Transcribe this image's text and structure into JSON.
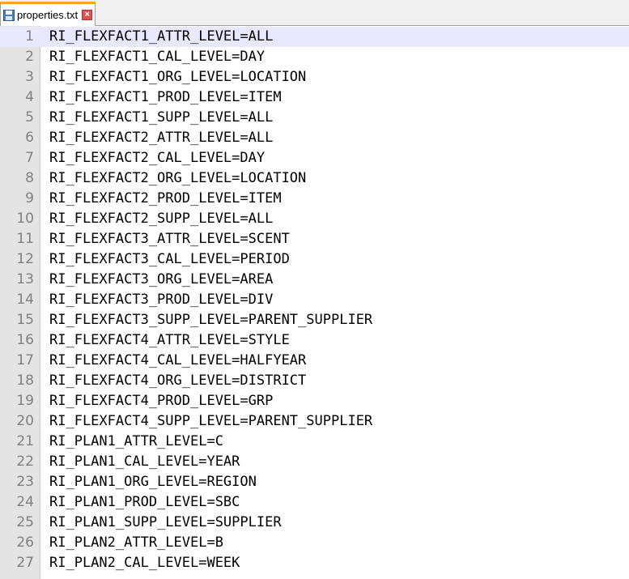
{
  "tab": {
    "label": "properties.txt",
    "icon": "file-saved-icon",
    "close_icon": "close-icon",
    "close_glyph": "×"
  },
  "colors": {
    "tab_accent": "#f5a623",
    "current_line": "#e8e8ff",
    "gutter": "#e4e4e4",
    "line_number": "#808080"
  },
  "editor": {
    "current_line": 1,
    "lines": [
      {
        "num": "1",
        "text": "RI_FLEXFACT1_ATTR_LEVEL=ALL"
      },
      {
        "num": "2",
        "text": "RI_FLEXFACT1_CAL_LEVEL=DAY"
      },
      {
        "num": "3",
        "text": "RI_FLEXFACT1_ORG_LEVEL=LOCATION"
      },
      {
        "num": "4",
        "text": "RI_FLEXFACT1_PROD_LEVEL=ITEM"
      },
      {
        "num": "5",
        "text": "RI_FLEXFACT1_SUPP_LEVEL=ALL"
      },
      {
        "num": "6",
        "text": "RI_FLEXFACT2_ATTR_LEVEL=ALL"
      },
      {
        "num": "7",
        "text": "RI_FLEXFACT2_CAL_LEVEL=DAY"
      },
      {
        "num": "8",
        "text": "RI_FLEXFACT2_ORG_LEVEL=LOCATION"
      },
      {
        "num": "9",
        "text": "RI_FLEXFACT2_PROD_LEVEL=ITEM"
      },
      {
        "num": "10",
        "text": "RI_FLEXFACT2_SUPP_LEVEL=ALL"
      },
      {
        "num": "11",
        "text": "RI_FLEXFACT3_ATTR_LEVEL=SCENT"
      },
      {
        "num": "12",
        "text": "RI_FLEXFACT3_CAL_LEVEL=PERIOD"
      },
      {
        "num": "13",
        "text": "RI_FLEXFACT3_ORG_LEVEL=AREA"
      },
      {
        "num": "14",
        "text": "RI_FLEXFACT3_PROD_LEVEL=DIV"
      },
      {
        "num": "15",
        "text": "RI_FLEXFACT3_SUPP_LEVEL=PARENT_SUPPLIER"
      },
      {
        "num": "16",
        "text": "RI_FLEXFACT4_ATTR_LEVEL=STYLE"
      },
      {
        "num": "17",
        "text": "RI_FLEXFACT4_CAL_LEVEL=HALFYEAR"
      },
      {
        "num": "18",
        "text": "RI_FLEXFACT4_ORG_LEVEL=DISTRICT"
      },
      {
        "num": "19",
        "text": "RI_FLEXFACT4_PROD_LEVEL=GRP"
      },
      {
        "num": "20",
        "text": "RI_FLEXFACT4_SUPP_LEVEL=PARENT_SUPPLIER"
      },
      {
        "num": "21",
        "text": "RI_PLAN1_ATTR_LEVEL=C"
      },
      {
        "num": "22",
        "text": "RI_PLAN1_CAL_LEVEL=YEAR"
      },
      {
        "num": "23",
        "text": "RI_PLAN1_ORG_LEVEL=REGION"
      },
      {
        "num": "24",
        "text": "RI_PLAN1_PROD_LEVEL=SBC"
      },
      {
        "num": "25",
        "text": "RI_PLAN1_SUPP_LEVEL=SUPPLIER"
      },
      {
        "num": "26",
        "text": "RI_PLAN2_ATTR_LEVEL=B"
      },
      {
        "num": "27",
        "text": "RI_PLAN2_CAL_LEVEL=WEEK"
      }
    ]
  }
}
